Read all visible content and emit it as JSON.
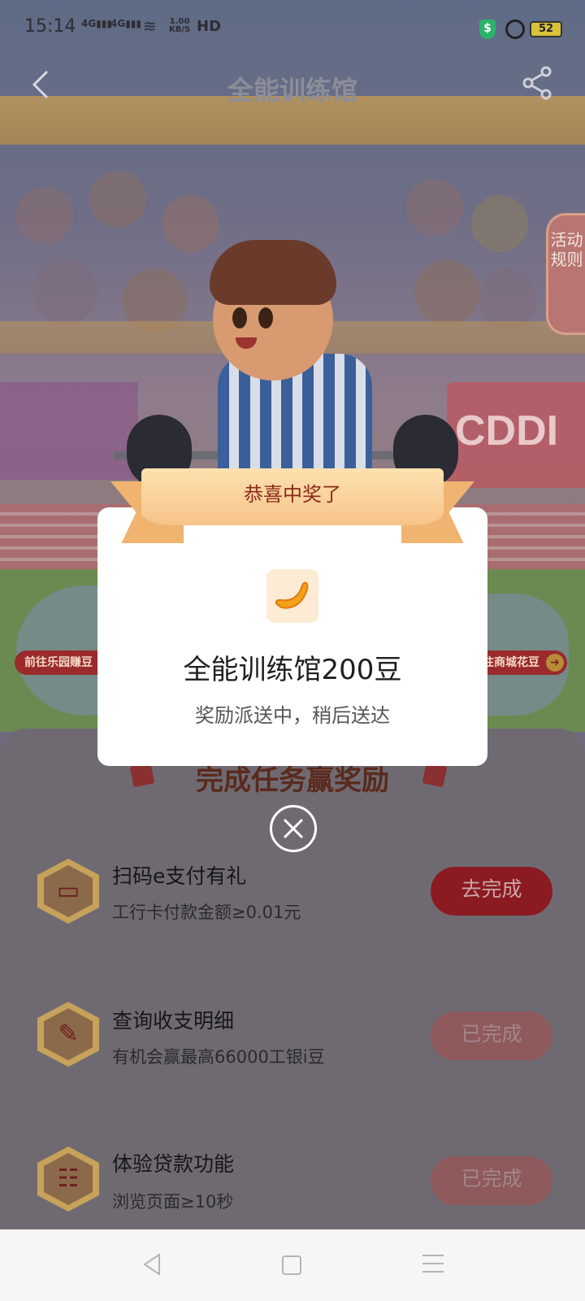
{
  "status_bar": {
    "time": "15:14",
    "net1": "4G",
    "net2": "4G",
    "speed_value": "1.00",
    "speed_unit": "KB/S",
    "hd": "HD",
    "battery": "52"
  },
  "header": {
    "title": "全能训练馆"
  },
  "side": {
    "rules_label": "活动规则",
    "left_pill": "前往乐园赚豆",
    "right_pill": "前往商城花豆"
  },
  "background_text": {
    "banner_right": "CDDI"
  },
  "tasks": {
    "title": "完成任务赢奖励",
    "items": [
      {
        "name": "扫码e支付有礼",
        "desc": "工行卡付款金额≥0.01元",
        "button": "去完成",
        "icon": "book-icon"
      },
      {
        "name": "查询收支明细",
        "desc": "有机会赢最高66000工银i豆",
        "button": "已完成",
        "icon": "pen-icon"
      },
      {
        "name": "体验贷款功能",
        "desc": "浏览页面≥10秒",
        "button": "已完成",
        "icon": "clipboard-icon"
      }
    ]
  },
  "modal": {
    "ribbon": "恭喜中奖了",
    "prize_name": "全能训练馆200豆",
    "prize_sub": "奖励派送中，稍后送达",
    "icon": "bean-icon"
  },
  "colors": {
    "accent": "#8c1a22",
    "ribbon": "#f6c48a",
    "modal_bg": "#ffffff"
  }
}
